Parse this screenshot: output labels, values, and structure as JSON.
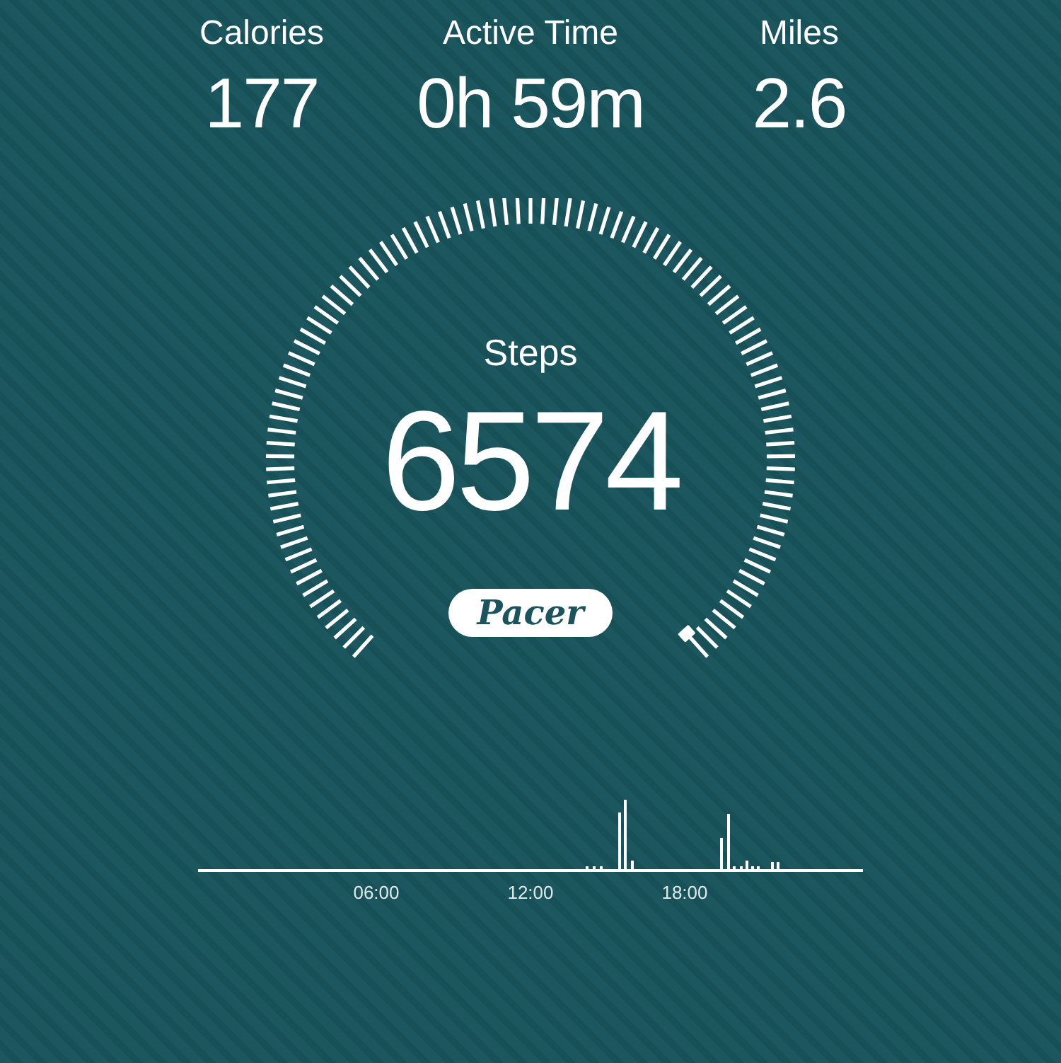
{
  "stats": [
    {
      "label": "Calories",
      "value": "177"
    },
    {
      "label": "Active Time",
      "value": "0h 59m"
    },
    {
      "label": "Miles",
      "value": "2.6"
    }
  ],
  "steps": {
    "label": "Steps",
    "value": "6574"
  },
  "logo": "Pacer",
  "activity_chart": {
    "time_labels": [
      "06:00",
      "12:00",
      "18:00"
    ]
  }
}
